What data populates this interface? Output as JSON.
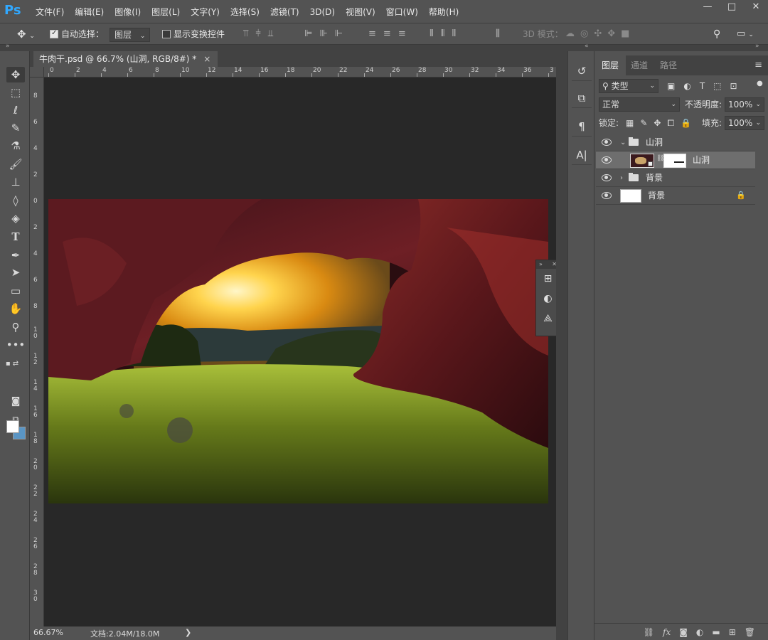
{
  "app": {
    "logo": "Ps"
  },
  "menu": [
    "文件(F)",
    "编辑(E)",
    "图像(I)",
    "图层(L)",
    "文字(Y)",
    "选择(S)",
    "滤镜(T)",
    "3D(D)",
    "视图(V)",
    "窗口(W)",
    "帮助(H)"
  ],
  "window_controls": {
    "minimize": "—",
    "maximize": "□",
    "close": "✕"
  },
  "options": {
    "auto_select_label": "自动选择：",
    "auto_select_checked": true,
    "auto_select_target": "图层",
    "show_transform_label": "显示变换控件",
    "mode_3d_label": "3D 模式："
  },
  "document": {
    "tab_title": "牛肉干.psd @ 66.7% (山洞, RGB/8#) *",
    "tab_close": "×",
    "zoom": "66.67%",
    "doc_size": "文档:2.04M/18.0M",
    "status_arrow": "❯"
  },
  "ruler": {
    "h_labels": [
      "0",
      "2",
      "4",
      "6",
      "8",
      "10",
      "12",
      "14",
      "16",
      "18",
      "20",
      "22",
      "24",
      "26",
      "28",
      "30",
      "32",
      "34",
      "36",
      "3"
    ],
    "v_labels": [
      "8",
      "6",
      "4",
      "2",
      "0",
      "2",
      "4",
      "6",
      "8",
      "1 0",
      "1 2",
      "1 4",
      "1 6",
      "1 8",
      "2 0",
      "2 2",
      "2 4",
      "2 6",
      "2 8",
      "3 0"
    ]
  },
  "layers_panel": {
    "tabs": [
      "图层",
      "通道",
      "路径"
    ],
    "active_tab": "图层",
    "filter_kind": "类型",
    "blend_mode": "正常",
    "opacity_label": "不透明度:",
    "opacity_value": "100%",
    "lock_label": "锁定:",
    "fill_label": "填充:",
    "fill_value": "100%",
    "layers": [
      {
        "name": "山洞",
        "type": "group",
        "expanded": true,
        "visible": true
      },
      {
        "name": "山洞",
        "type": "layer",
        "selected": true,
        "has_mask": true,
        "visible": true
      },
      {
        "name": "背景",
        "type": "group",
        "expanded": false,
        "visible": true
      },
      {
        "name": "背景",
        "type": "background",
        "locked": true,
        "visible": true
      }
    ],
    "footer_icons": [
      "link-icon",
      "fx-icon",
      "mask-icon",
      "adjustment-icon",
      "folder-icon",
      "new-layer-icon",
      "trash-icon"
    ],
    "footer_fx": "fx"
  },
  "colors": {
    "ui_panel": "#535353",
    "canvas_bg": "#282828",
    "foreground": "#ffffff",
    "background": "#5a95c4",
    "logo": "#31a8ff"
  }
}
